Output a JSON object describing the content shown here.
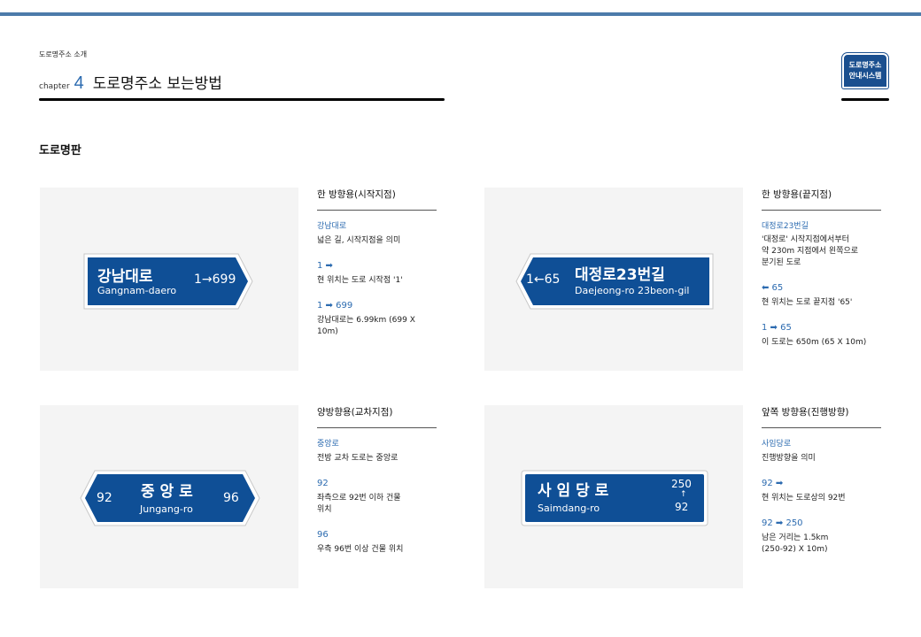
{
  "header": {
    "breadcrumb": "도로명주소 소개",
    "chapter_label": "chapter",
    "chapter_number": "4",
    "title": "도로명주소 보는방법",
    "logo_line1": "도로명주소",
    "logo_line2": "안내시스템"
  },
  "section_title": "도로명판",
  "signs": {
    "gangnam": {
      "name_ko": "강남대로",
      "name_en": "Gangnam-daero",
      "range": "1→699"
    },
    "daejeong": {
      "range": "1←65",
      "name_ko": "대정로23번길",
      "name_en": "Daejeong-ro 23beon-gil"
    },
    "jungang": {
      "left": "92",
      "name_ko": "중 앙 로",
      "name_en": "Jungang-ro",
      "right": "96"
    },
    "saimdang": {
      "name_ko": "사 임 당 로",
      "name_en": "Saimdang-ro",
      "top": "250",
      "arrow": "↑",
      "bottom": "92"
    }
  },
  "desc1": {
    "title": "한 방향용(시작지점)",
    "a_blue": "강남대로",
    "a_txt": "넓은 길, 시작지점을 의미",
    "b_blue": "1 ➡",
    "b_txt": "현 위치는 도로 시작점 '1'",
    "c_blue": "1 ➡ 699",
    "c_txt": "강남대로는 6.99km (699 X 10m)"
  },
  "desc2": {
    "title": "한 방향용(끝지점)",
    "a_blue": "대정로23번길",
    "a_txt1": "'대정로' 시작지점에서부터",
    "a_txt2": "약 230m 지점에서 왼쪽으로",
    "a_txt3": "분기된 도로",
    "b_blue": "⬅ 65",
    "b_txt": "현 위치는 도로 끝지점 '65'",
    "c_blue": "1 ➡ 65",
    "c_txt": "이 도로는 650m (65 X 10m)"
  },
  "desc3": {
    "title": "양방향용(교차지점)",
    "a_blue": "중앙로",
    "a_txt": "전방 교차 도로는 중앙로",
    "b_blue": "92",
    "b_txt1": "좌측으로 92번 이하 건물",
    "b_txt2": "위치",
    "c_blue": "96",
    "c_txt": "우측 96번 이상 건물 위치"
  },
  "desc4": {
    "title": "앞쪽 방향용(진행방향)",
    "a_blue": "사임당로",
    "a_txt": "진행방향을 의미",
    "b_blue": "92 ➡",
    "b_txt": "현 위치는 도로상의 92번",
    "c_blue": "92 ➡ 250",
    "c_txt1": "남은 거리는 1.5km",
    "c_txt2": "(250-92) X 10m)"
  },
  "colors": {
    "sign_blue": "#0f4f96",
    "accent_blue": "#2c6bb0",
    "card_bg": "#f4f4f4",
    "top_bar": "#4c7baa"
  }
}
